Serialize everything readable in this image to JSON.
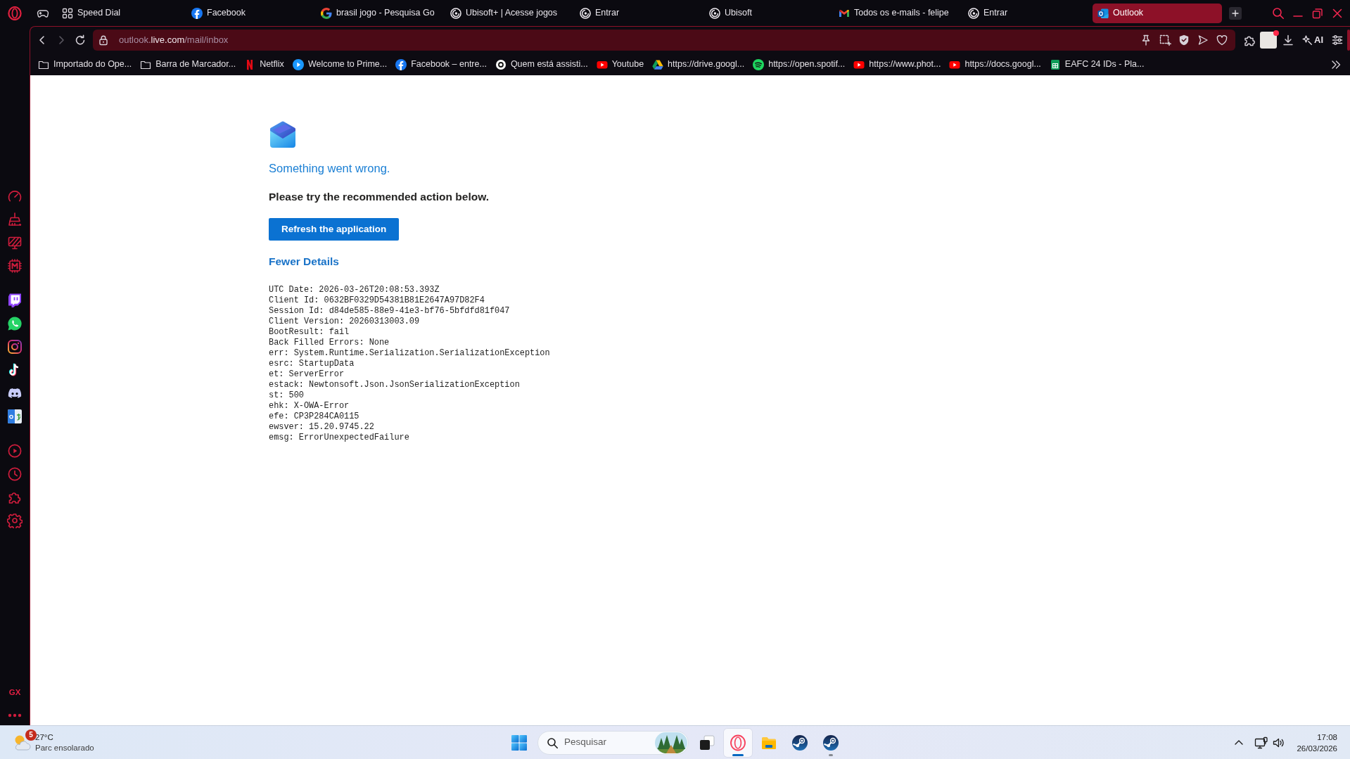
{
  "tab_strip": {
    "tabs": [
      {
        "title": "Speed Dial",
        "selected": false
      },
      {
        "title": "Facebook",
        "selected": false
      },
      {
        "title": "brasil jogo - Pesquisa Go",
        "selected": false
      },
      {
        "title": "Ubisoft+ | Acesse jogos",
        "selected": false
      },
      {
        "title": "Entrar",
        "selected": false
      },
      {
        "title": "Ubisoft",
        "selected": false
      },
      {
        "title": "Todos os e-mails - felipe",
        "selected": false
      },
      {
        "title": "Entrar",
        "selected": false
      },
      {
        "title": "Outlook",
        "selected": true
      }
    ]
  },
  "toolbar": {
    "back": {
      "disabled": false
    },
    "forward": {
      "disabled": true
    },
    "url": {
      "subdomain": "outlook.",
      "domain": "live.com",
      "path": "/mail/inbox"
    },
    "ai_label": "AI"
  },
  "bookmarks": [
    "Importado do Ope...",
    "Barra de Marcador...",
    "Netflix",
    "Welcome to Prime...",
    "Facebook – entre...",
    "Quem está assisti...",
    "Youtube",
    "https://drive.googl...",
    "https://open.spotif...",
    "https://www.phot...",
    "https://docs.googl...",
    "EAFC 24 IDs - Pla..."
  ],
  "sidebar": {
    "gx_label": "GX"
  },
  "error_page": {
    "heading": "Something went wrong.",
    "message": "Please try the recommended action below.",
    "action_button": "Refresh the application",
    "details_toggle": "Fewer Details",
    "details": [
      "UTC Date: 2026-03-26T20:08:53.393Z",
      "Client Id: 0632BF0329D54381B81E2647A97D82F4",
      "Session Id: d84de585-88e9-41e3-bf76-5bfdfd81f047",
      "Client Version: 20260313003.09",
      "BootResult: fail",
      "Back Filled Errors: None",
      "err: System.Runtime.Serialization.SerializationException",
      "esrc: StartupData",
      "et: ServerError",
      "estack: Newtonsoft.Json.JsonSerializationException",
      "st: 500",
      "ehk: X-OWA-Error",
      "efe: CP3P284CA0115",
      "ewsver: 15.20.9745.22",
      "emsg: ErrorUnexpectedFailure"
    ]
  },
  "taskbar": {
    "weather": {
      "badge": "5",
      "temperature": "27°C",
      "condition": "Parc ensolarado"
    },
    "search": {
      "placeholder": "Pesquisar"
    },
    "apps": [
      {
        "focused": false,
        "running": false
      },
      {
        "focused": true,
        "running": true
      },
      {
        "focused": false,
        "running": false
      },
      {
        "focused": false,
        "running": false
      },
      {
        "focused": false,
        "running": true
      }
    ],
    "clock": {
      "time": "17:08",
      "date": "26/03/2026"
    }
  }
}
